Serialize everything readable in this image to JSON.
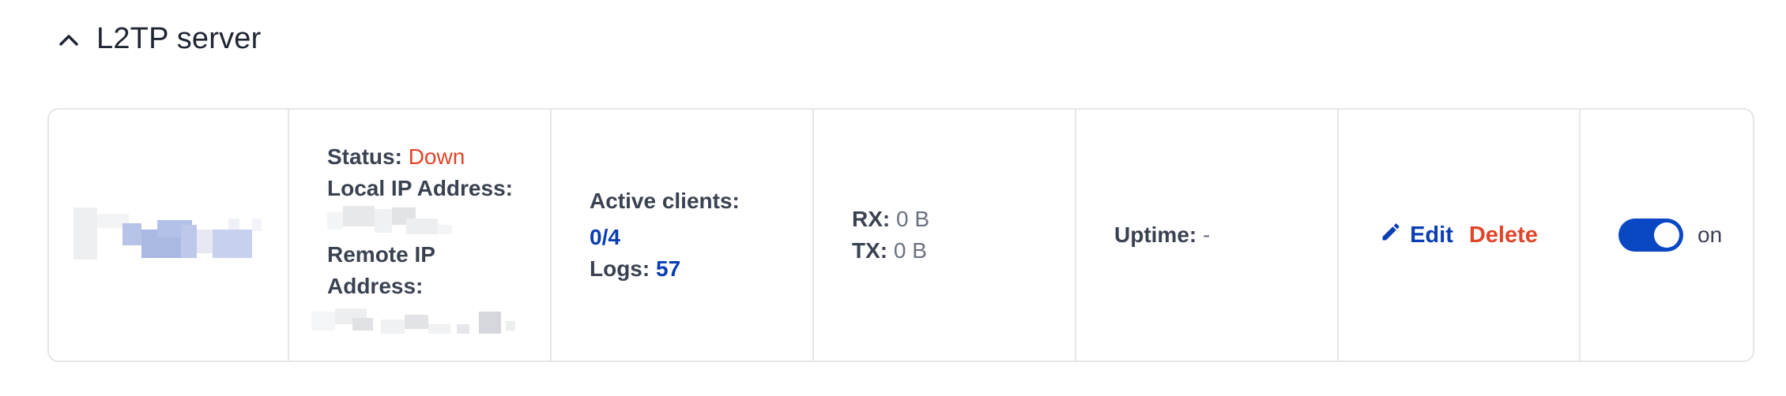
{
  "section": {
    "title": "L2TP server",
    "collapse_icon": "chevron-up-icon"
  },
  "server": {
    "status_label": "Status:",
    "status_value": "Down",
    "local_ip_label": "Local IP Address:",
    "remote_ip_label": "Remote IP Address:",
    "active_clients_label": "Active clients:",
    "active_clients_value": "0/4",
    "logs_label": "Logs:",
    "logs_value": "57",
    "rx_label": "RX:",
    "rx_value": "0 B",
    "tx_label": "TX:",
    "tx_value": "0 B",
    "uptime_label": "Uptime:",
    "uptime_value": "-"
  },
  "actions": {
    "edit_label": "Edit",
    "edit_icon": "pencil-icon",
    "delete_label": "Delete"
  },
  "toggle": {
    "state_label": "on",
    "enabled": true
  },
  "colors": {
    "accent": "#0a47c2",
    "link": "#0a3eb5",
    "danger": "#e0452a",
    "border": "#e3e6ea",
    "text": "#3a4252"
  }
}
